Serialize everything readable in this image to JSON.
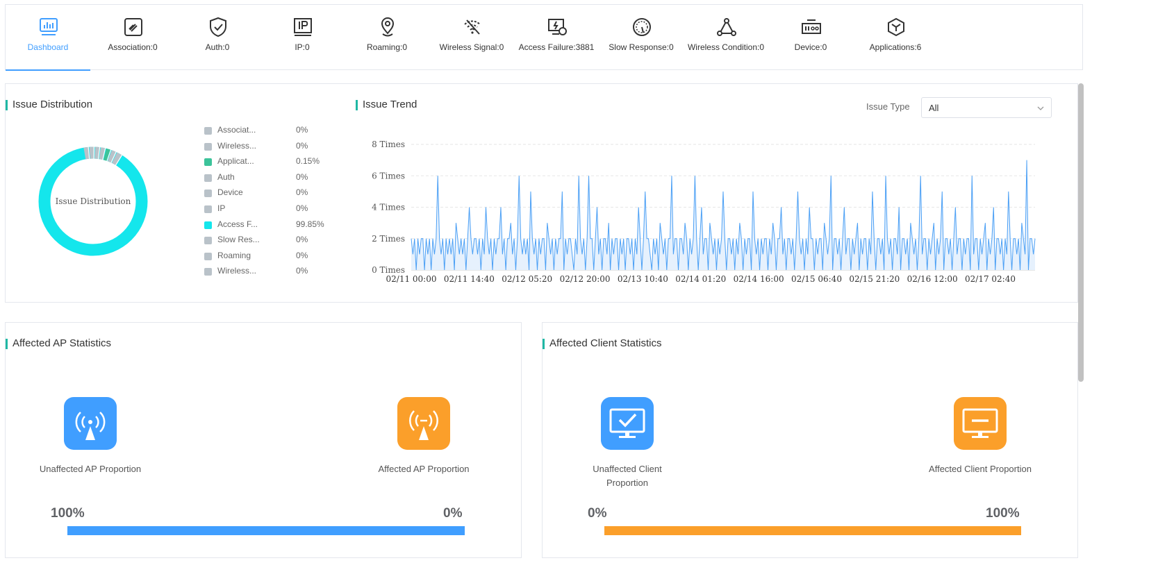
{
  "tabs": [
    {
      "label": "Dashboard",
      "icon": "dashboard-icon",
      "active": true
    },
    {
      "label": "Association:0",
      "icon": "association-icon",
      "active": false
    },
    {
      "label": "Auth:0",
      "icon": "shield-check-icon",
      "active": false
    },
    {
      "label": "IP:0",
      "icon": "ip-icon",
      "active": false
    },
    {
      "label": "Roaming:0",
      "icon": "location-pin-icon",
      "active": false
    },
    {
      "label": "Wireless Signal:0",
      "icon": "wifi-off-icon",
      "active": false
    },
    {
      "label": "Access Failure:3881",
      "icon": "access-failure-icon",
      "active": false
    },
    {
      "label": "Slow Response:0",
      "icon": "gauge-icon",
      "active": false
    },
    {
      "label": "Wireless Condition:0",
      "icon": "network-nodes-icon",
      "active": false
    },
    {
      "label": "Device:0",
      "icon": "device-icon",
      "active": false
    },
    {
      "label": "Applications:6",
      "icon": "cube-icon",
      "active": false
    }
  ],
  "distribution": {
    "title": "Issue Distribution",
    "center_label": "Issue Distribution",
    "legend": [
      {
        "name": "Associat...",
        "pct": "0%",
        "color": "#b9c2c9"
      },
      {
        "name": "Wireless...",
        "pct": "0%",
        "color": "#b9c2c9"
      },
      {
        "name": "Applicat...",
        "pct": "0.15%",
        "color": "#3cc39a"
      },
      {
        "name": "Auth",
        "pct": "0%",
        "color": "#b9c2c9"
      },
      {
        "name": "Device",
        "pct": "0%",
        "color": "#b9c2c9"
      },
      {
        "name": "IP",
        "pct": "0%",
        "color": "#b9c2c9"
      },
      {
        "name": "Access F...",
        "pct": "99.85%",
        "color": "#14e6ec"
      },
      {
        "name": "Slow Res...",
        "pct": "0%",
        "color": "#b9c2c9"
      },
      {
        "name": "Roaming",
        "pct": "0%",
        "color": "#b9c2c9"
      },
      {
        "name": "Wireless...",
        "pct": "0%",
        "color": "#b9c2c9"
      }
    ]
  },
  "trend": {
    "title": "Issue Trend",
    "issue_type_label": "Issue Type",
    "issue_type_value": "All"
  },
  "chart_data": {
    "type": "line",
    "title": "Issue Trend",
    "y_ticks": [
      "0 Times",
      "2 Times",
      "4 Times",
      "6 Times",
      "8 Times"
    ],
    "ylim": [
      0,
      8
    ],
    "x_ticks": [
      "02/11 00:00",
      "02/11 14:40",
      "02/12 05:20",
      "02/12 20:00",
      "02/13 10:40",
      "02/14 01:20",
      "02/14 16:00",
      "02/15 06:40",
      "02/15 21:20",
      "02/16 12:00",
      "02/17 02:40"
    ],
    "grid": true,
    "series": [
      {
        "color": "#4a9ff5",
        "values": [
          2,
          1,
          2,
          0,
          2,
          1,
          2,
          2,
          0,
          2,
          1,
          2,
          0,
          2,
          1,
          2,
          6,
          2,
          1,
          2,
          0,
          2,
          1,
          2,
          1,
          2,
          0,
          3,
          2,
          1,
          2,
          1,
          2,
          0,
          2,
          4,
          2,
          1,
          2,
          2,
          1,
          2,
          0,
          2,
          1,
          4,
          2,
          1,
          2,
          0,
          2,
          1,
          2,
          2,
          4,
          1,
          2,
          0,
          2,
          2,
          3,
          1,
          2,
          0,
          2,
          6,
          2,
          1,
          2,
          1,
          2,
          0,
          5,
          2,
          1,
          2,
          0,
          2,
          1,
          2,
          2,
          0,
          3,
          2,
          1,
          2,
          0,
          2,
          1,
          2,
          2,
          5,
          0,
          2,
          1,
          2,
          2,
          1,
          0,
          2,
          1,
          6,
          2,
          1,
          2,
          0,
          2,
          6,
          2,
          2,
          0,
          2,
          4,
          1,
          2,
          0,
          2,
          2,
          1,
          3,
          0,
          2,
          1,
          2,
          2,
          0,
          2,
          1,
          2,
          0,
          2,
          2,
          1,
          2,
          0,
          2,
          1,
          4,
          2,
          0,
          2,
          5,
          2,
          2,
          1,
          0,
          2,
          1,
          2,
          0,
          3,
          2,
          1,
          2,
          0,
          2,
          2,
          6,
          1,
          2,
          2,
          0,
          2,
          2,
          1,
          3,
          2,
          0,
          2,
          1,
          2,
          6,
          2,
          0,
          2,
          4,
          1,
          2,
          2,
          0,
          3,
          2,
          1,
          2,
          0,
          2,
          1,
          2,
          5,
          2,
          0,
          2,
          2,
          1,
          2,
          0,
          2,
          1,
          3,
          2,
          0,
          2,
          1,
          2,
          2,
          0,
          5,
          2,
          1,
          2,
          0,
          2,
          1,
          2,
          2,
          0,
          2,
          1,
          3,
          2,
          0,
          2,
          2,
          4,
          1,
          2,
          0,
          2,
          2,
          1,
          2,
          0,
          2,
          5,
          2,
          1,
          2,
          0,
          2,
          1,
          4,
          2,
          2,
          0,
          2,
          1,
          2,
          2,
          0,
          3,
          2,
          1,
          2,
          6,
          0,
          2,
          2,
          1,
          2,
          0,
          2,
          4,
          1,
          2,
          2,
          0,
          2,
          1,
          2,
          3,
          0,
          2,
          1,
          2,
          2,
          0,
          2,
          1,
          5,
          2,
          0,
          2,
          2,
          1,
          2,
          0,
          6,
          2,
          1,
          2,
          0,
          2,
          2,
          1,
          4,
          0,
          2,
          2,
          1,
          2,
          0,
          3,
          2,
          1,
          2,
          0,
          2,
          6,
          1,
          2,
          2,
          0,
          2,
          1,
          2,
          3,
          0,
          2,
          1,
          2,
          5,
          0,
          2,
          2,
          1,
          2,
          0,
          2,
          4,
          1,
          2,
          2,
          0,
          2,
          1,
          2,
          2,
          0,
          6,
          1,
          2,
          2,
          0,
          2,
          1,
          2,
          3,
          0,
          2,
          1,
          2,
          4,
          0,
          2,
          2,
          1,
          2,
          0,
          2,
          1,
          5,
          2,
          0,
          2,
          2,
          1,
          2,
          0,
          3,
          2,
          1,
          7,
          0,
          2,
          2,
          1,
          2
        ]
      }
    ]
  },
  "ap_stats": {
    "title": "Affected AP Statistics",
    "unaffected_label": "Unaffected AP Proportion",
    "affected_label": "Affected AP Proportion",
    "unaffected_pct": "100%",
    "affected_pct": "0%",
    "unaffected_fraction": 1.0,
    "unaffected_color": "#409eff",
    "affected_color": "#fb9f2a"
  },
  "client_stats": {
    "title": "Affected Client Statistics",
    "unaffected_label": "Unaffected Client Proportion",
    "affected_label": "Affected Client Proportion",
    "unaffected_pct": "0%",
    "affected_pct": "100%",
    "affected_fraction": 1.0,
    "unaffected_color": "#409eff",
    "affected_color": "#fb9f2a"
  }
}
